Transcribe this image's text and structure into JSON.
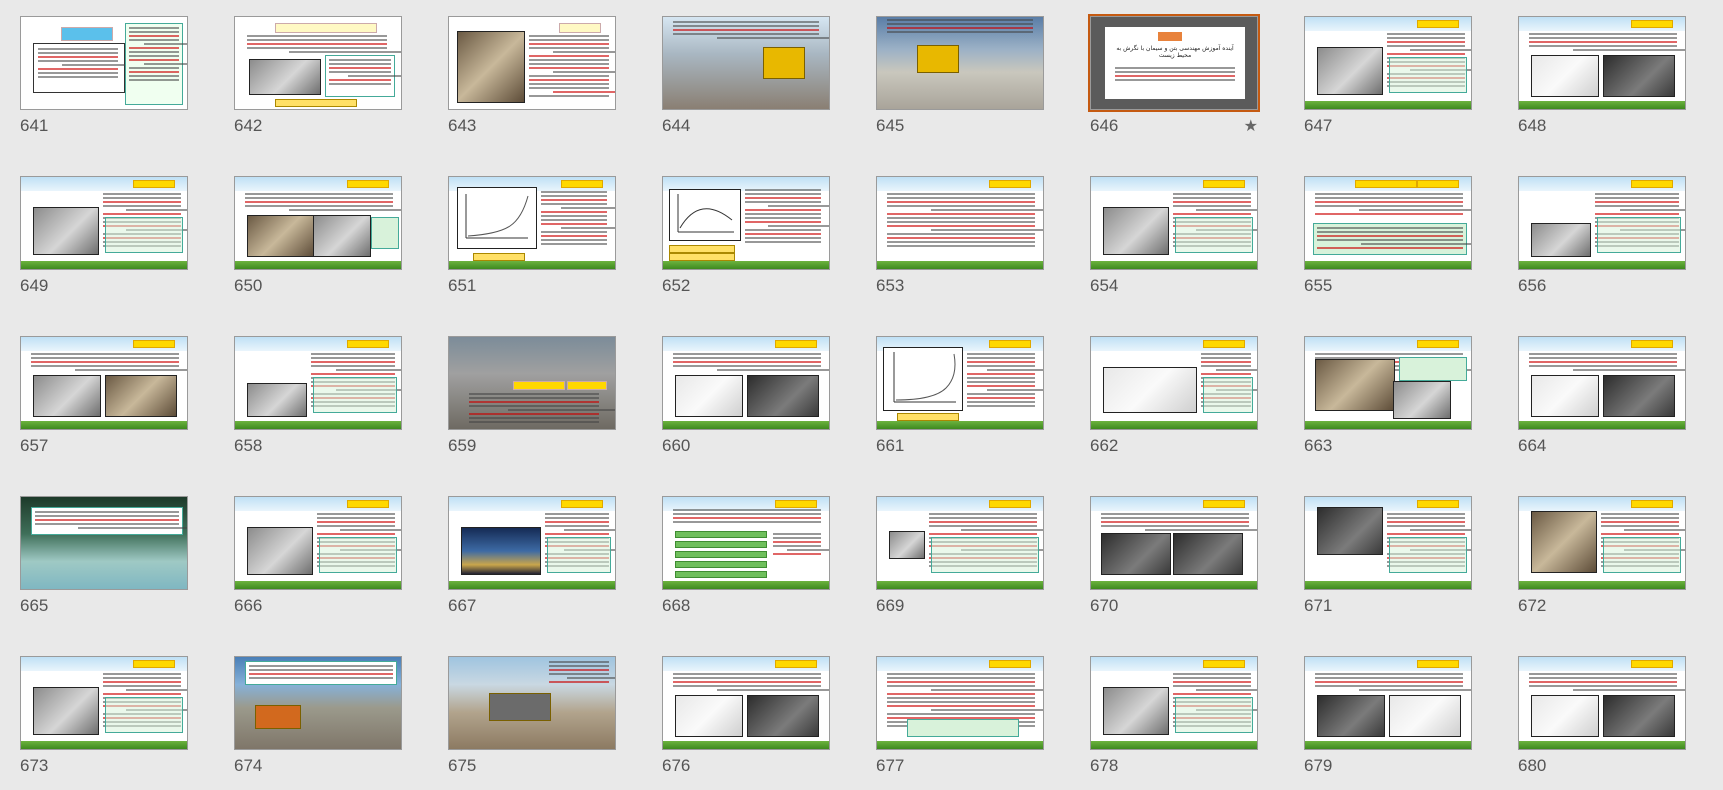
{
  "view": "slide-sorter",
  "selected_slide": "646",
  "starred_slide": "646",
  "slides": [
    {
      "number": "641",
      "theme": "green-table"
    },
    {
      "number": "642",
      "theme": "green-photo"
    },
    {
      "number": "643",
      "theme": "green-photo-left"
    },
    {
      "number": "644",
      "theme": "photo-excavator"
    },
    {
      "number": "645",
      "theme": "photo-machine"
    },
    {
      "number": "646",
      "theme": "title-card"
    },
    {
      "number": "647",
      "theme": "sky-photo-left"
    },
    {
      "number": "648",
      "theme": "sky-two-photos"
    },
    {
      "number": "649",
      "theme": "sky-photo-left"
    },
    {
      "number": "650",
      "theme": "sky-two-photos-wide"
    },
    {
      "number": "651",
      "theme": "sky-chart"
    },
    {
      "number": "652",
      "theme": "sky-chart2"
    },
    {
      "number": "653",
      "theme": "sky-text"
    },
    {
      "number": "654",
      "theme": "sky-photo-left"
    },
    {
      "number": "655",
      "theme": "sky-text-boxes"
    },
    {
      "number": "656",
      "theme": "sky-photo-left-small"
    },
    {
      "number": "657",
      "theme": "sky-two-photos"
    },
    {
      "number": "658",
      "theme": "sky-photo-left-small"
    },
    {
      "number": "659",
      "theme": "photo-pour"
    },
    {
      "number": "660",
      "theme": "sky-two-photos"
    },
    {
      "number": "661",
      "theme": "sky-chart3"
    },
    {
      "number": "662",
      "theme": "sky-photo-left-wide"
    },
    {
      "number": "663",
      "theme": "sky-two-photos-stacked"
    },
    {
      "number": "664",
      "theme": "sky-two-photos"
    },
    {
      "number": "665",
      "theme": "photo-bridge"
    },
    {
      "number": "666",
      "theme": "sky-photo-left"
    },
    {
      "number": "667",
      "theme": "sky-photo-night"
    },
    {
      "number": "668",
      "theme": "sky-diagram"
    },
    {
      "number": "669",
      "theme": "sky-photo-small"
    },
    {
      "number": "670",
      "theme": "sky-two-photos-white"
    },
    {
      "number": "671",
      "theme": "sky-photo-hands"
    },
    {
      "number": "672",
      "theme": "sky-cement-bags"
    },
    {
      "number": "673",
      "theme": "sky-photo-left"
    },
    {
      "number": "674",
      "theme": "photo-crusher"
    },
    {
      "number": "675",
      "theme": "photo-crusher2"
    },
    {
      "number": "676",
      "theme": "sky-two-photos"
    },
    {
      "number": "677",
      "theme": "sky-text-box"
    },
    {
      "number": "678",
      "theme": "sky-photo-left"
    },
    {
      "number": "679",
      "theme": "sky-two-photos"
    },
    {
      "number": "680",
      "theme": "sky-two-photos"
    }
  ],
  "title_card": {
    "heading": "آینده آموزش مهندسی بتن و سیمان با نگرش به محیط زیست"
  },
  "slide_652_chart": {
    "type": "scatter-curve"
  },
  "colors": {
    "accent": "#c55a11",
    "grass": "#4f9a2a",
    "title_bar": "#ffd800"
  }
}
